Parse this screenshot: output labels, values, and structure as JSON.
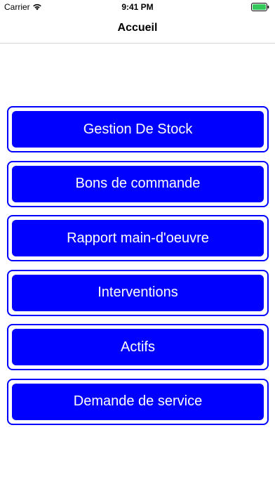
{
  "status_bar": {
    "carrier": "Carrier",
    "time": "9:41 PM",
    "wifi_icon": "wifi-icon",
    "battery_icon": "battery-icon",
    "battery_color": "#34c759"
  },
  "nav": {
    "title": "Accueil"
  },
  "menu": {
    "accent_color": "#0000ff",
    "items": [
      {
        "label": "Gestion De Stock"
      },
      {
        "label": "Bons de commande"
      },
      {
        "label": "Rapport main-d'oeuvre"
      },
      {
        "label": "Interventions"
      },
      {
        "label": "Actifs"
      },
      {
        "label": "Demande de service"
      }
    ]
  }
}
